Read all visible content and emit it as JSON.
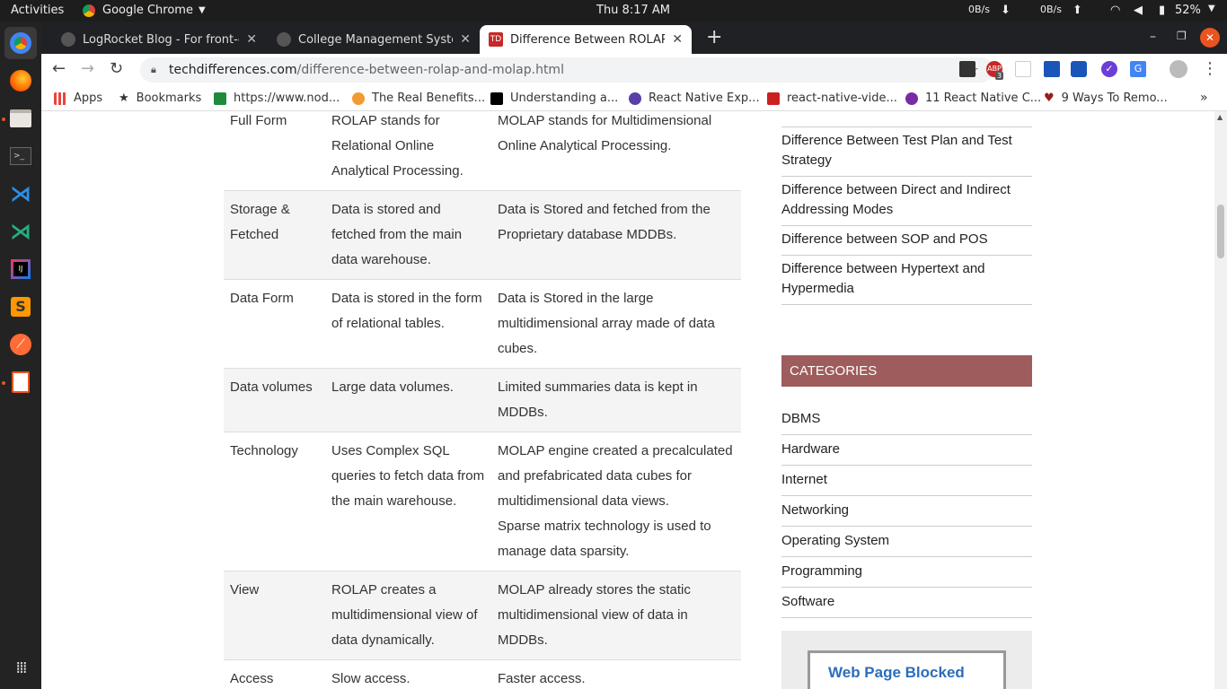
{
  "topbar": {
    "activities": "Activities",
    "app": "Google Chrome",
    "clock": "Thu  8:17 AM",
    "net_down": "0B/s",
    "net_up": "0B/s",
    "battery": "52%"
  },
  "tabs": [
    {
      "title": "LogRocket Blog - For front-en"
    },
    {
      "title": "College Management System"
    },
    {
      "title": "Difference Between ROLAP ar"
    }
  ],
  "toolbar": {
    "url_host": "techdifferences.com",
    "url_path": "/difference-between-rolap-and-molap.html",
    "ext_badge": "3"
  },
  "bookmarks": [
    {
      "label": "Apps",
      "color": "#e8453c"
    },
    {
      "label": "Bookmarks",
      "color": "#333333"
    },
    {
      "label": "https://www.nod...",
      "color": "#1e8a3e"
    },
    {
      "label": "The Real Benefits...",
      "color": "#f29b30"
    },
    {
      "label": "Understanding a...",
      "color": "#000000"
    },
    {
      "label": "React Native Exp...",
      "color": "#5b3fa8"
    },
    {
      "label": "react-native-vide...",
      "color": "#cc1f1f"
    },
    {
      "label": "11 React Native C...",
      "color": "#7b2aa5"
    },
    {
      "label": "9 Ways To Remo...",
      "color": "#9b1b1b"
    }
  ],
  "table": {
    "rows": [
      {
        "basis": "Full Form",
        "rolap": "ROLAP stands for Relational Online Analytical Processing.",
        "molap": "MOLAP stands for Multidimensional Online Analytical Processing."
      },
      {
        "basis": "Storage & Fetched",
        "rolap": "Data is stored and fetched from the main data warehouse.",
        "molap": "Data is Stored and fetched from the Proprietary database MDDBs."
      },
      {
        "basis": "Data Form",
        "rolap": "Data is stored in the form of relational tables.",
        "molap": "Data is Stored in the large multidimensional array made of data cubes."
      },
      {
        "basis": "Data volumes",
        "rolap": "Large data volumes.",
        "molap": "Limited summaries data is kept in MDDBs."
      },
      {
        "basis": "Technology",
        "rolap": "Uses Complex SQL queries to fetch data from the main warehouse.",
        "molap": "MOLAP engine created a precalculated and prefabricated data cubes for multidimensional data views.",
        "molap2": "Sparse matrix technology is used to manage data sparsity."
      },
      {
        "basis": "View",
        "rolap": "ROLAP creates a multidimensional view of data dynamically.",
        "molap": "MOLAP already stores the static multidimensional view of data in MDDBs."
      },
      {
        "basis": "Access",
        "rolap": "Slow access.",
        "molap": "Faster access."
      }
    ]
  },
  "sidebar": {
    "related": [
      "Difference Between Test Plan and Test Strategy",
      "Difference between Direct and Indirect Addressing Modes",
      "Difference between SOP and POS",
      "Difference between Hypertext and Hypermedia"
    ],
    "categories_title": "CATEGORIES",
    "categories": [
      "DBMS",
      "Hardware",
      "Internet",
      "Networking",
      "Operating System",
      "Programming",
      "Software"
    ],
    "promo_text": "Web Page Blocked"
  }
}
